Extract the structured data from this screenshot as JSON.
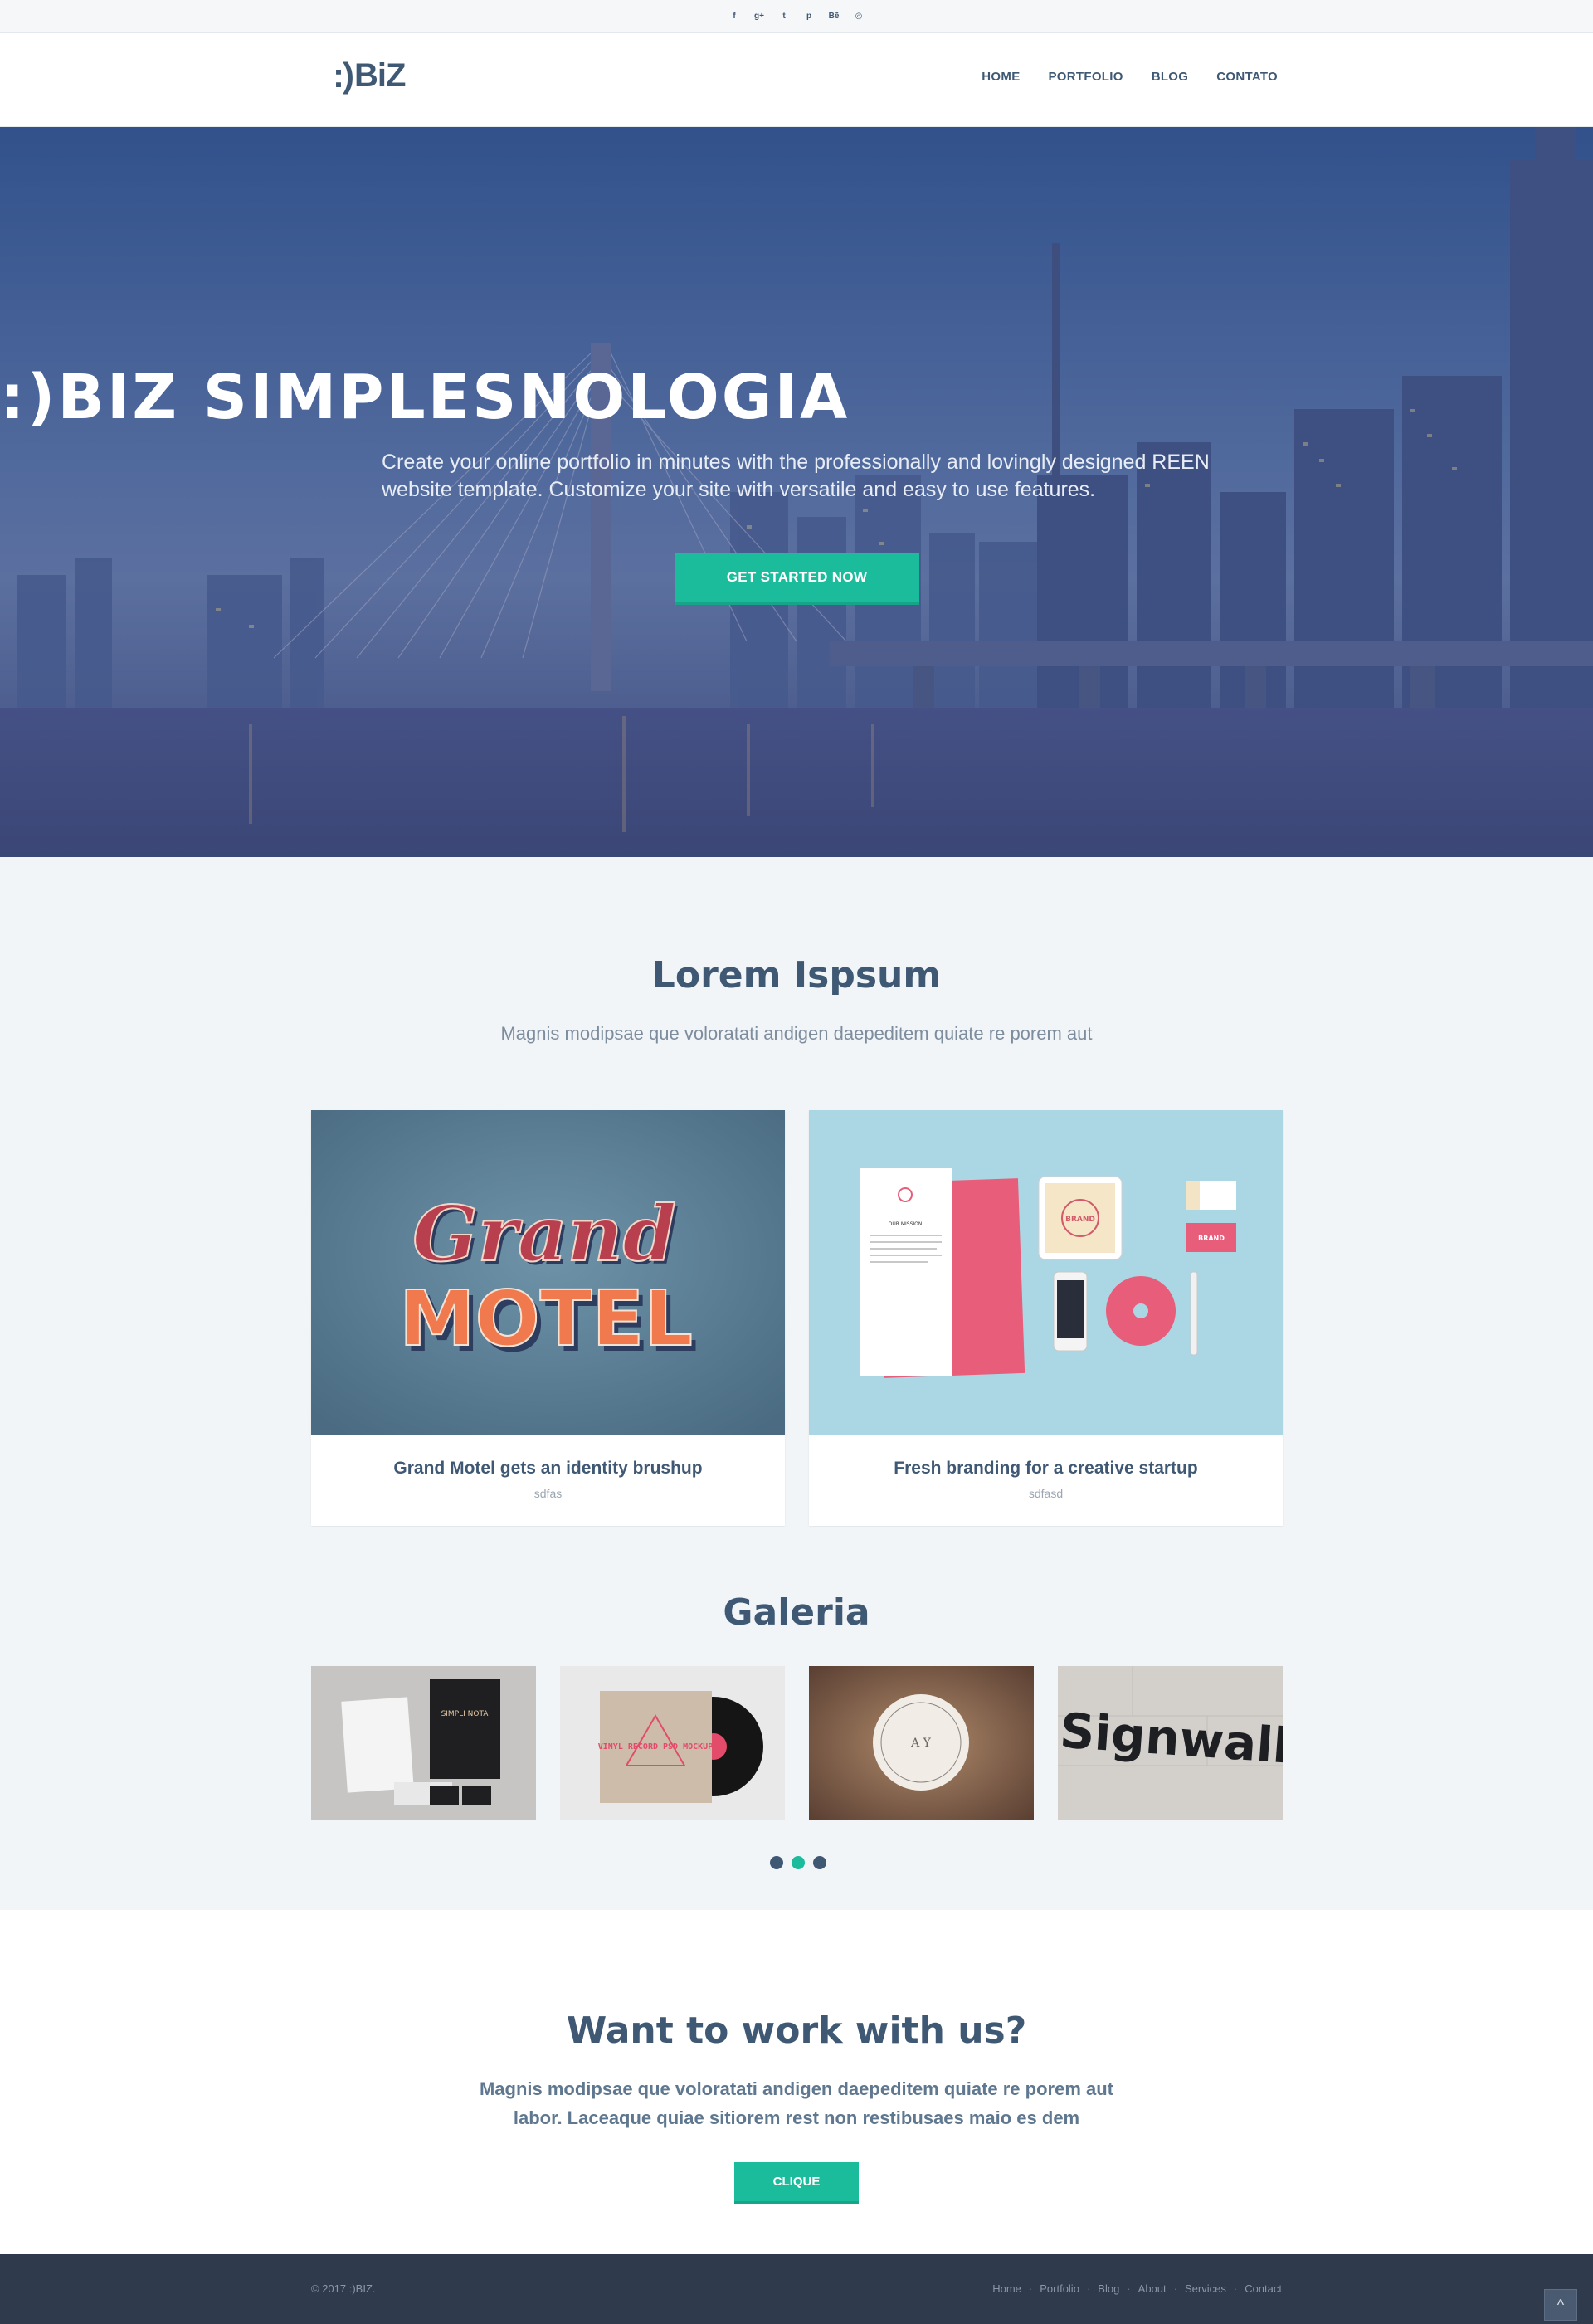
{
  "social": {
    "icons": [
      {
        "name": "facebook-icon",
        "glyph": "f"
      },
      {
        "name": "google-plus-icon",
        "glyph": "g+"
      },
      {
        "name": "twitter-icon",
        "glyph": "t"
      },
      {
        "name": "pinterest-icon",
        "glyph": "p"
      },
      {
        "name": "behance-icon",
        "glyph": "Bē"
      },
      {
        "name": "dribbble-icon",
        "glyph": "◎"
      }
    ]
  },
  "header": {
    "logo_smile": ":)",
    "logo_text": "BiZ",
    "nav": [
      {
        "label": "HOME"
      },
      {
        "label": "PORTFOLIO"
      },
      {
        "label": "BLOG"
      },
      {
        "label": "CONTATO"
      }
    ]
  },
  "hero": {
    "title": ":)BIZ SIMPLESNOLOGIA",
    "subtitle": "Create your online portfolio in minutes with the professionally and lovingly designed REEN website template. Customize your site with versatile and easy to use features.",
    "cta_label": "GET STARTED NOW"
  },
  "intro": {
    "title": "Lorem Ispsum",
    "subtitle": "Magnis modipsae que voloratati andigen daepeditem quiate re porem aut"
  },
  "cards": [
    {
      "title": "Grand Motel gets an identity brushup",
      "subtitle": "sdfas",
      "image_text_top": "Grand",
      "image_text_bottom": "MOTEL"
    },
    {
      "title": "Fresh branding for a creative startup",
      "subtitle": "sdfasd",
      "image_text_top": "BRAND",
      "image_text_bottom": "OUR MISSION"
    }
  ],
  "gallery": {
    "title": "Galeria",
    "items": [
      {
        "caption": "SIMPLI NOTA"
      },
      {
        "caption": "VINYL RECORD PSD MOCKUP"
      },
      {
        "caption": "A Y"
      },
      {
        "caption": "Signwall"
      }
    ],
    "active_dot": 1
  },
  "work": {
    "title": "Want to work with us?",
    "text": "Magnis modipsae que voloratati andigen daepeditem quiate re porem aut labor. Laceaque quiae sitiorem rest non restibusaes maio es dem",
    "button_label": "CLIQUE"
  },
  "footer": {
    "copyright": "© 2017 :)BIZ.",
    "links": [
      "Home",
      "Portfolio",
      "Blog",
      "About",
      "Services",
      "Contact"
    ],
    "separator": "·",
    "back_to_top_glyph": "^"
  },
  "colors": {
    "accent": "#1abc9c",
    "primary": "#3f5874",
    "footer_bg": "#2f3b4d"
  }
}
